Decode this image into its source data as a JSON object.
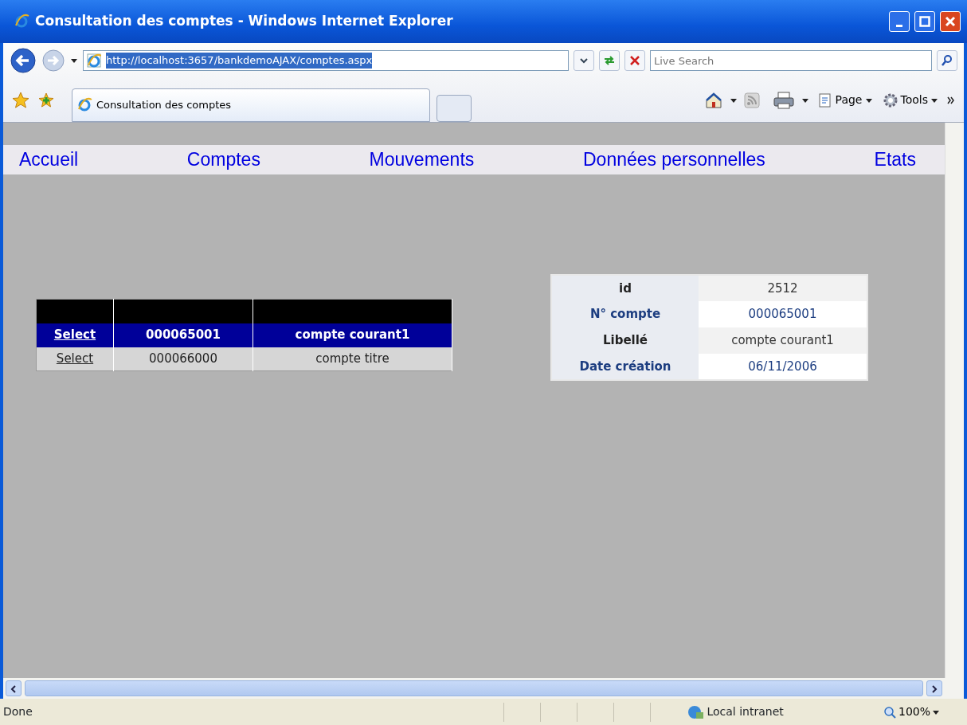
{
  "window": {
    "title": "Consultation des comptes - Windows Internet Explorer"
  },
  "address_bar": {
    "url": "http://localhost:3657/bankdemoAJAX/comptes.aspx"
  },
  "search": {
    "placeholder": "Live Search"
  },
  "tabs": [
    {
      "label": "Consultation des comptes",
      "selected": true
    }
  ],
  "commands": [
    "Page",
    "Tools"
  ],
  "menu": [
    "Accueil",
    "Comptes",
    "Mouvements",
    "Données personnelles",
    "Etats"
  ],
  "accounts_grid": {
    "rows": [
      {
        "action": "Select",
        "number": "000065001",
        "label": "compte courant1",
        "selected": true
      },
      {
        "action": "Select",
        "number": "000066000",
        "label": "compte titre",
        "selected": false
      }
    ]
  },
  "details": [
    {
      "field": "id",
      "value": "2512"
    },
    {
      "field": "N° compte",
      "value": "000065001"
    },
    {
      "field": "Libellé",
      "value": "compte courant1"
    },
    {
      "field": "Date création",
      "value": "06/11/2006"
    }
  ],
  "status_bar": {
    "text": "Done",
    "zone": "Local intranet",
    "zoom": "100%"
  }
}
